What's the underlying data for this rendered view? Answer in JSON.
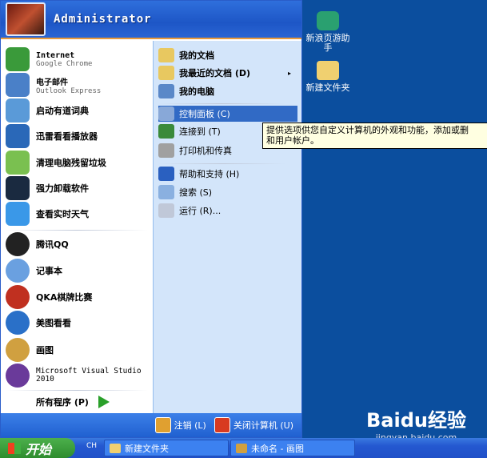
{
  "user": {
    "name": "Administrator"
  },
  "pinned": [
    {
      "title": "Internet",
      "sub": "Google Chrome",
      "color": "#3a9a3a"
    },
    {
      "title": "电子邮件",
      "sub": "Outlook Express",
      "color": "#4a80c8"
    },
    {
      "title": "启动有道词典",
      "color": "#5a9ad8"
    },
    {
      "title": "迅雷看看播放器",
      "color": "#2a68b8"
    },
    {
      "title": "清理电脑残留垃圾",
      "color": "#7ac050"
    },
    {
      "title": "强力卸载软件",
      "color": "#1a2a40"
    },
    {
      "title": "查看实时天气",
      "color": "#3a98e8"
    }
  ],
  "recent": [
    {
      "title": "腾讯QQ",
      "color": "#222"
    },
    {
      "title": "记事本",
      "color": "#6aa0e0"
    },
    {
      "title": "QKA棋牌比赛",
      "color": "#c03020"
    },
    {
      "title": "美图看看",
      "color": "#2a70c8"
    },
    {
      "title": "画图",
      "color": "#d0a040"
    },
    {
      "title": "Microsoft Visual Studio 2010",
      "color": "#6a3a9a"
    }
  ],
  "all_programs": "所有程序 (P)",
  "places": [
    {
      "label": "我的文档",
      "bold": true,
      "color": "#e8c860"
    },
    {
      "label": "我最近的文档 (D)",
      "bold": true,
      "color": "#e8c860",
      "submenu": "▸"
    },
    {
      "label": "我的电脑",
      "bold": true,
      "color": "#5a88c8"
    },
    {
      "label": "控制面板 (C)",
      "color": "#88a8d8",
      "highlighted": true
    },
    {
      "label": "连接到 (T)",
      "color": "#3a8a3a"
    },
    {
      "label": "打印机和传真",
      "color": "#a0a0a0"
    },
    {
      "label": "帮助和支持 (H)",
      "color": "#2a60c0"
    },
    {
      "label": "搜索 (S)",
      "color": "#8ab0e0"
    },
    {
      "label": "运行 (R)...",
      "color": "#c0c8d8"
    }
  ],
  "tooltip": "提供选项供您自定义计算机的外观和功能，添加或删除程序，设置网络连接和用户帐户。",
  "tooltip_visible": "提供选项供您自定义计算机的外观和功能，添加或删\n和用户帐户。",
  "footer": {
    "logoff": "注销 (L)",
    "shutdown": "关闭计算机 (U)"
  },
  "desktop": [
    {
      "label": "新浪页游助手"
    },
    {
      "label": "新建文件夹"
    }
  ],
  "taskbar": {
    "start": "开始",
    "quicklaunch": "CH",
    "tasks": [
      "新建文件夹",
      "未命名 - 画图"
    ]
  },
  "watermark": {
    "brand": "Baidu经验",
    "url": "jingyan.baidu.com"
  }
}
